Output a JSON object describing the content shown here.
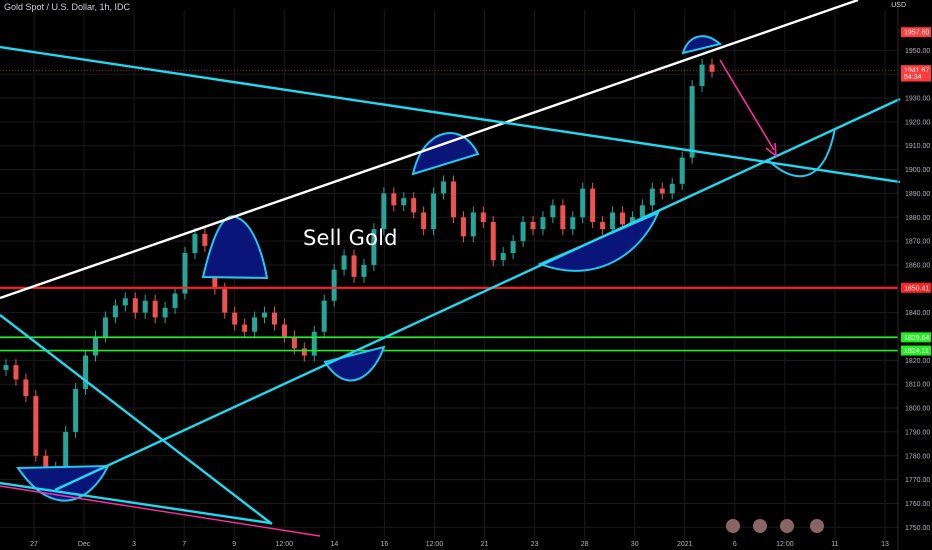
{
  "title": "Gold Spot / U.S. Dollar, 1h, IDC",
  "currency": "USD",
  "annotation": "Sell Gold",
  "colors": {
    "background": "#000000",
    "grid": "#1b1b1b",
    "candle_up": "#26a69a",
    "candle_down": "#ef5350",
    "resistance": "#ff2020",
    "support": "#22ee22",
    "upper_channel": "#ffffff",
    "cyan_trend": "#22d8ee",
    "pattern_fill": "#0a157a",
    "pattern_edge": "#22c8f0",
    "arrow": "#ff2da6",
    "current_price_tag": "#ff3b3b"
  },
  "chart_data": {
    "type": "line",
    "title": "Gold Spot / U.S. Dollar, 1h, IDC",
    "ylabel": "USD",
    "ylim": [
      1745,
      1962
    ],
    "y_ticks": [
      1750,
      1760,
      1770,
      1780,
      1790,
      1800,
      1810,
      1820,
      1830,
      1840,
      1850,
      1860,
      1870,
      1880,
      1890,
      1900,
      1910,
      1920,
      1930,
      1940,
      1950
    ],
    "x_ticks": [
      "27",
      "Dec",
      "3",
      "7",
      "9",
      "12:00",
      "14",
      "16",
      "12:00",
      "21",
      "23",
      "28",
      "30",
      "2021",
      "6",
      "12:00",
      "11",
      "13"
    ],
    "price_tags": [
      {
        "label": "1957.60",
        "value": 1957.6,
        "color": "#ff3b3b"
      },
      {
        "label": "1941.67",
        "value": 1941.67,
        "color": "#ff3b3b"
      },
      {
        "label": "54:34",
        "value": 1939.0,
        "color": "#ff3b3b"
      },
      {
        "label": "1850.41",
        "value": 1850.41,
        "color": "#ff2020"
      },
      {
        "label": "1829.64",
        "value": 1829.64,
        "color": "#22ee22"
      },
      {
        "label": "1824.11",
        "value": 1824.11,
        "color": "#22ee22"
      }
    ],
    "horizontal_levels": [
      {
        "value": 1850.41,
        "color": "#ff2020"
      },
      {
        "value": 1829.64,
        "color": "#22ee22"
      },
      {
        "value": 1824.11,
        "color": "#22ee22"
      }
    ],
    "series": [
      {
        "values": [
          1818,
          1812,
          1805,
          1780,
          1772,
          1775,
          1790,
          1808,
          1822,
          1830,
          1838,
          1843,
          1846,
          1840,
          1845,
          1838,
          1842,
          1848,
          1865,
          1873,
          1868,
          1850,
          1840,
          1835,
          1832,
          1838,
          1840,
          1835,
          1830,
          1825,
          1822,
          1832,
          1845,
          1858,
          1864,
          1855,
          1860,
          1875,
          1890,
          1885,
          1888,
          1882,
          1875,
          1890,
          1895,
          1880,
          1872,
          1882,
          1878,
          1862,
          1865,
          1870,
          1878,
          1875,
          1880,
          1885,
          1875,
          1880,
          1892,
          1878,
          1875,
          1882,
          1877,
          1880,
          1885,
          1892,
          1890,
          1894,
          1905,
          1935,
          1944,
          1941
        ]
      }
    ]
  }
}
